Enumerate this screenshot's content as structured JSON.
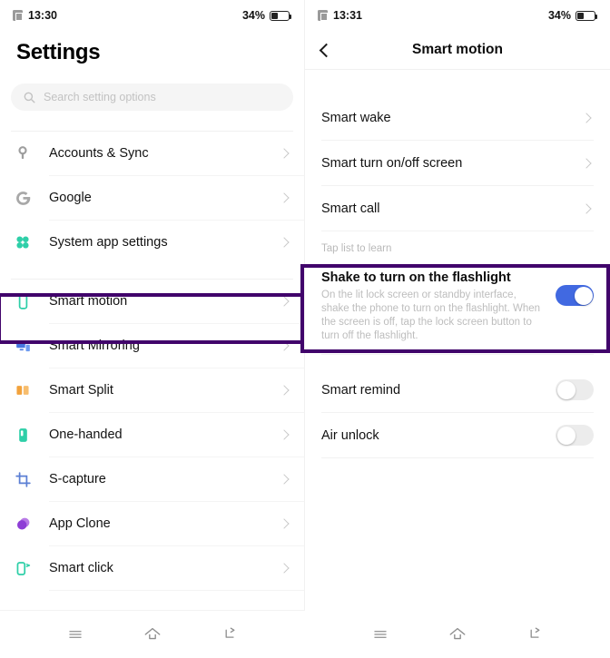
{
  "left": {
    "status": {
      "time": "13:30",
      "battery_percent": "34%",
      "sim_icon": "sim-card-icon",
      "battery_icon": "battery-icon"
    },
    "title": "Settings",
    "search": {
      "placeholder": "Search setting options",
      "icon": "search-icon"
    },
    "items": [
      {
        "label": "Accounts & Sync",
        "icon": "key-icon",
        "color": "#9e9e9e"
      },
      {
        "label": "Google",
        "icon": "google-g-icon",
        "color": "#9e9e9e"
      },
      {
        "label": "System app settings",
        "icon": "four-dots-icon",
        "color": "#2ecfa8"
      },
      {
        "label": "Smart motion",
        "icon": "phone-outline-icon",
        "color": "#2ecfa8"
      },
      {
        "label": "Smart Mirroring",
        "icon": "screen-cast-icon",
        "color": "#4676e0"
      },
      {
        "label": "Smart Split",
        "icon": "split-screen-icon",
        "color": "#f2a23c"
      },
      {
        "label": "One-handed",
        "icon": "one-handed-icon",
        "color": "#2ecfa8"
      },
      {
        "label": "S-capture",
        "icon": "crop-capture-icon",
        "color": "#5b7fd4"
      },
      {
        "label": "App Clone",
        "icon": "app-clone-icon",
        "color": "#9c4dd6"
      },
      {
        "label": "Smart click",
        "icon": "smart-click-icon",
        "color": "#2ecfa8"
      }
    ],
    "highlight_index": 3
  },
  "right": {
    "status": {
      "time": "13:31",
      "battery_percent": "34%",
      "sim_icon": "sim-card-icon",
      "battery_icon": "battery-icon"
    },
    "nav": {
      "back_icon": "back-chevron-icon",
      "title": "Smart motion"
    },
    "items": [
      {
        "label": "Smart wake"
      },
      {
        "label": "Smart turn on/off screen"
      },
      {
        "label": "Smart call"
      }
    ],
    "hint": "Tap list to learn",
    "flashlight": {
      "title": "Shake to turn on the flashlight",
      "description": "On the lit lock screen or standby interface, shake the phone to turn on the flashlight. When the screen is off, tap the lock screen button to turn off the flashlight.",
      "toggle_state": "on"
    },
    "toggles": [
      {
        "label": "Smart remind",
        "state": "off"
      },
      {
        "label": "Air unlock",
        "state": "off"
      }
    ]
  },
  "navbar": {
    "menu_icon": "menu-icon",
    "home_icon": "home-icon",
    "back_icon": "back-arrow-icon"
  },
  "colors": {
    "highlight_border": "#41046b",
    "toggle_on": "#4169e1",
    "accent_teal": "#2ecfa8"
  }
}
